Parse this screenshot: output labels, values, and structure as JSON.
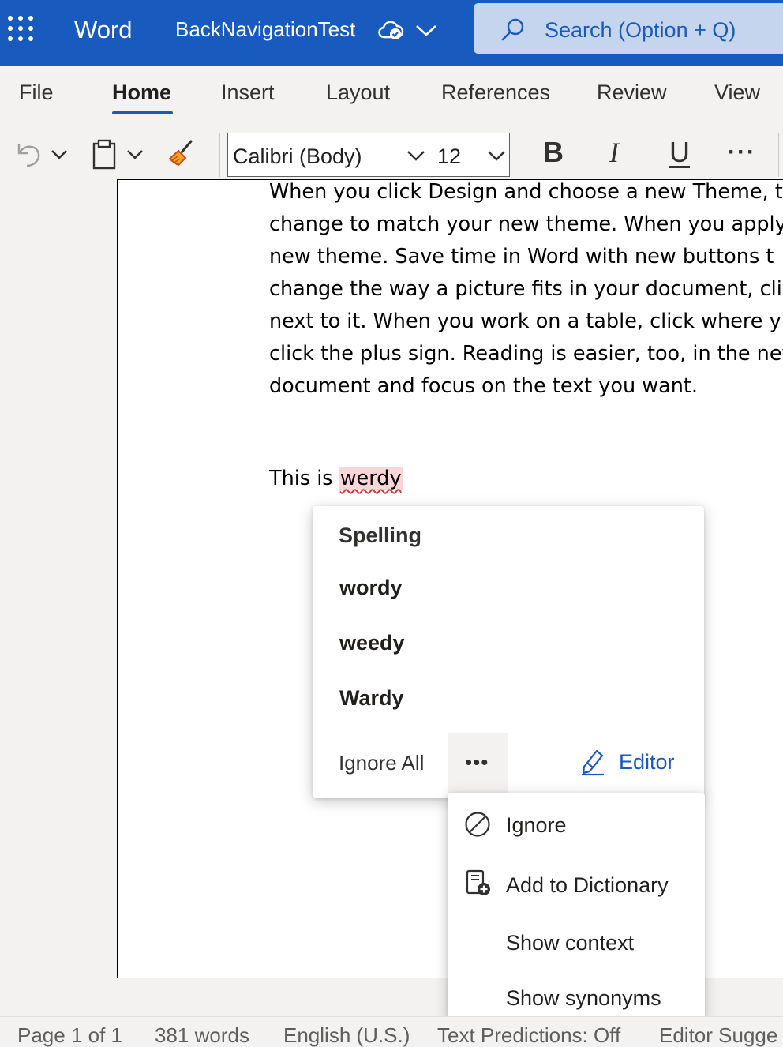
{
  "titlebar": {
    "app_name": "Word",
    "document_name": "BackNavigationTest",
    "search_placeholder": "Search (Option + Q)",
    "background_color": "#185abd"
  },
  "ribbon": {
    "tabs": [
      "File",
      "Home",
      "Insert",
      "Layout",
      "References",
      "Review",
      "View"
    ],
    "active_tab": "Home",
    "font_name": "Calibri (Body)",
    "font_size": "12",
    "bold_label": "B",
    "italic_label": "I",
    "underline_label": "U",
    "more_label": "···"
  },
  "document": {
    "lines": [
      "When you click Design and choose a new Theme, t",
      "change to match your new theme. When you apply",
      "new theme. Save time in Word with new buttons t",
      "change the way a picture fits in your document, cli",
      "next to it. When you work on a table, click where y",
      "click the plus sign. Reading is easier, too, in the nev",
      "document and focus on the text you want."
    ],
    "typed_prefix": "This is ",
    "misspelled_word": "werdy"
  },
  "spelling_popup": {
    "heading": "Spelling",
    "suggestions": [
      "wordy",
      "weedy",
      "Wardy"
    ],
    "ignore_all": "Ignore All",
    "more_options": "•••",
    "editor_label": "Editor",
    "accent_color": "#185abd"
  },
  "more_menu": {
    "items": [
      {
        "label": "Ignore",
        "icon": "prohibited-icon"
      },
      {
        "label": "Add to Dictionary",
        "icon": "dictionary-add-icon"
      },
      {
        "label": "Show context",
        "icon": ""
      },
      {
        "label": "Show synonyms",
        "icon": ""
      }
    ]
  },
  "statusbar": {
    "page": "Page 1 of 1",
    "words": "381 words",
    "language": "English (U.S.)",
    "text_predictions": "Text Predictions: Off",
    "editor_suggestions": "Editor Sugge"
  }
}
